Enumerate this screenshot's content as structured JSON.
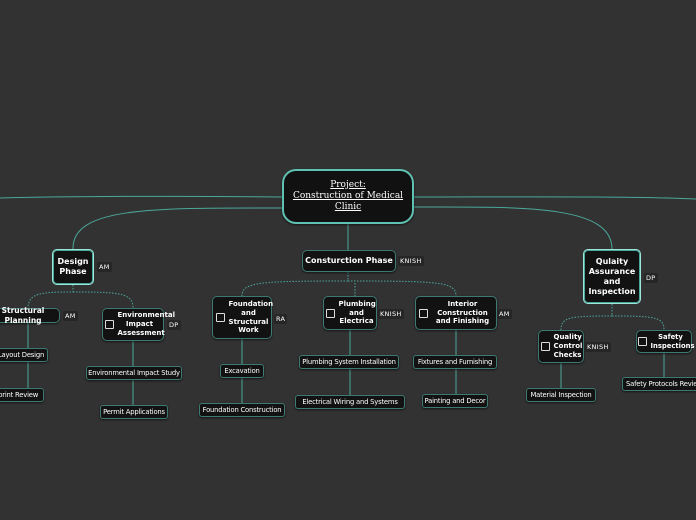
{
  "diagram": {
    "central": {
      "line1": "Project:",
      "line2": "Construction of Medical",
      "line3": "Clinic "
    },
    "design_phase": {
      "label": "Design Phase",
      "tag": "AM",
      "structural_planning": {
        "label": "Structural Planning",
        "tag": "AM"
      },
      "layout_design": {
        "label": "Layout Design"
      },
      "blueprint_review": {
        "label": "Blueprint Review"
      },
      "environmental_impact": {
        "label": "Environmental Impact Assessment",
        "tag": "DP"
      },
      "environmental_study": {
        "label": "Environmental Impact Study"
      },
      "permit_applications": {
        "label": "Permit Applications"
      }
    },
    "construction_phase": {
      "label": "Consturction Phase",
      "tag": "KNISH",
      "foundation": {
        "label": "Foundation and Structural Work",
        "tag": "RA"
      },
      "excavation": {
        "label": "Excavation"
      },
      "foundation_construction": {
        "label": "Foundation Construction"
      },
      "plumbing": {
        "label": "Plumbing and Electrica",
        "tag": "KNISH"
      },
      "plumbing_installation": {
        "label": "Plumbing System Installation"
      },
      "electrical_wiring": {
        "label": "Electrical Wiring and Systems"
      },
      "interior": {
        "label": "Interior Construction and Finishing",
        "tag": "AM"
      },
      "fixtures": {
        "label": "Fixtures and Furnishing"
      },
      "painting": {
        "label": "Painting and Decor"
      }
    },
    "quality_assurance": {
      "label": "Qulaity Assurance and Inspection",
      "tag": "DP",
      "quality_control": {
        "label": "Quality Control Checks",
        "tag": "KNISH"
      },
      "material_inspection": {
        "label": "Material Inspection"
      },
      "safety_inspections": {
        "label": "Safety Inspections"
      },
      "safety_protocols": {
        "label": "Safety Protocols Review"
      }
    }
  },
  "colors": {
    "background": "#333233",
    "node_fill": "#121212",
    "connector": "#4aa89a",
    "central_border": "#5fc1b1"
  },
  "icons": {
    "checkbox": "checkbox-icon"
  }
}
